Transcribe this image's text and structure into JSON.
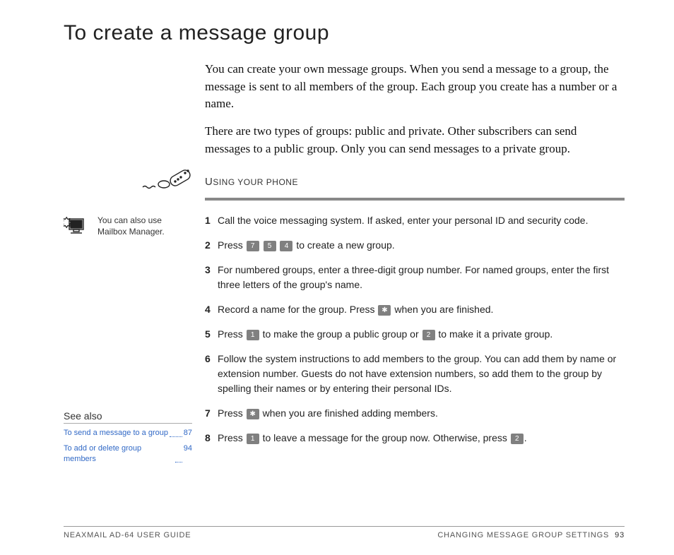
{
  "title": "To create a message group",
  "intro": [
    "You can create your own message groups. When you send a message to a group, the message is sent to all members of the group. Each group you create has a number or a name.",
    "There are two types of groups: public and private. Other subscribers can send messages to a public group. Only you can send messages to a private group."
  ],
  "section_first": "U",
  "section_rest": "SING YOUR PHONE",
  "tip": "You can also use Mailbox Manager.",
  "steps": {
    "s1": "Call the voice messaging system. If asked, enter your personal ID and security code.",
    "s2a": "Press ",
    "s2b": " to create a new group.",
    "s3": "For numbered groups, enter a three-digit group number. For named groups, enter the first three letters of the group's name.",
    "s4a": "Record a name for the group. Press ",
    "s4b": " when you are finished.",
    "s5a": "Press ",
    "s5b": " to make the group a public group or ",
    "s5c": " to make it a private group.",
    "s6": "Follow the system instructions to add members to the group. You can add them by name or extension number. Guests do not have extension numbers, so add them to the group by spelling their names or by entering their personal IDs.",
    "s7a": "Press ",
    "s7b": " when you are finished adding members.",
    "s8a": "Press ",
    "s8b": " to leave a message for the group now. Otherwise, press ",
    "s8c": "."
  },
  "keys": {
    "k7": "7",
    "k5": "5",
    "k4": "4",
    "star": "✱",
    "k1": "1",
    "k2": "2"
  },
  "see_also": {
    "head": "See also",
    "links": [
      {
        "text": "To send a message to a group",
        "page": "87"
      },
      {
        "text": "To add or delete group members",
        "page": "94"
      }
    ]
  },
  "footer": {
    "left": "NEAXMAIL AD-64 USER GUIDE",
    "right": "CHANGING MESSAGE GROUP SETTINGS",
    "page": "93"
  }
}
